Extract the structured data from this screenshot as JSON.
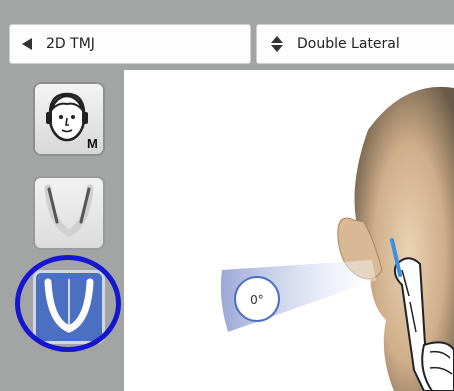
{
  "toolbar": {
    "mode_label": "2D TMJ",
    "view_label": "Double Lateral"
  },
  "sidebar": {
    "face_button_badge": "M"
  },
  "canvas": {
    "angle_label": "0°"
  },
  "colors": {
    "accent": "#4b6fc1",
    "highlight": "#1616d0"
  }
}
